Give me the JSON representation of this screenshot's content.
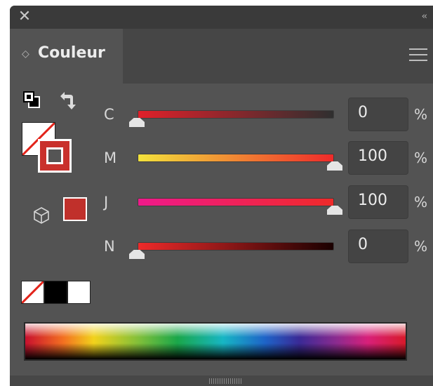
{
  "panel": {
    "tab_title": "Couleur",
    "close_icon": "close-icon",
    "collapse_label": "‹‹",
    "menu_icon": "hamburger-menu-icon"
  },
  "sliders": [
    {
      "label": "C",
      "value": "0",
      "unit": "%",
      "level": 0
    },
    {
      "label": "M",
      "value": "100",
      "unit": "%",
      "level": 1
    },
    {
      "label": "J",
      "value": "100",
      "unit": "%",
      "level": 1
    },
    {
      "label": "N",
      "value": "0",
      "unit": "%",
      "level": 0
    }
  ],
  "colors": {
    "current_fill": "#c0302b",
    "stroke": "#c9312c",
    "panel_bg": "#535353",
    "c_track": [
      "#e0202a",
      "#2f2f2f"
    ],
    "m_track": [
      "#f2e23c",
      "#ee2a2a"
    ],
    "j_track": [
      "#ee1a8a",
      "#ee2a2a"
    ],
    "n_track": [
      "#ee2a2a",
      "#1a0000"
    ]
  },
  "quick_swatches": [
    "none",
    "#000000",
    "#ffffff"
  ]
}
